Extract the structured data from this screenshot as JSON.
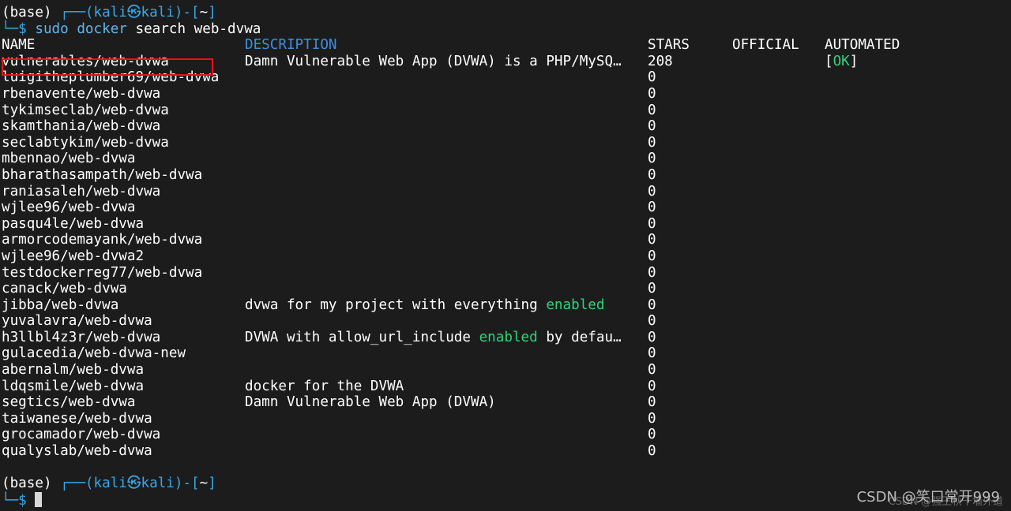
{
  "prompt1": {
    "base": "(base) ",
    "corner": "┌──(",
    "user": "kali㉿",
    "host": "kali",
    "mid": ")-[",
    "dir": "~",
    "end": "]",
    "corner2": "└─$ ",
    "cmd_sudo": "sudo",
    "cmd_docker": "docker",
    "cmd_args": " search web-dvwa"
  },
  "headers": {
    "name": "NAME",
    "description": "DESCRIPTION",
    "stars": "STARS",
    "official": "OFFICIAL",
    "automated": "AUTOMATED"
  },
  "rows": [
    {
      "name": "vulnerables/web-dvwa",
      "desc_a": "Damn Vulnerable Web App (DVWA) is a PHP/MySQ…",
      "desc_hl": "",
      "desc_b": "",
      "stars": "208",
      "auto_open": "[",
      "auto_ok": "OK",
      "auto_close": "]"
    },
    {
      "name": "luigitheplumber69/web-dvwa",
      "desc_a": "",
      "desc_hl": "",
      "desc_b": "",
      "stars": "0",
      "auto_open": "",
      "auto_ok": "",
      "auto_close": ""
    },
    {
      "name": "rbenavente/web-dvwa",
      "desc_a": "",
      "desc_hl": "",
      "desc_b": "",
      "stars": "0",
      "auto_open": "",
      "auto_ok": "",
      "auto_close": ""
    },
    {
      "name": "tykimseclab/web-dvwa",
      "desc_a": "",
      "desc_hl": "",
      "desc_b": "",
      "stars": "0",
      "auto_open": "",
      "auto_ok": "",
      "auto_close": ""
    },
    {
      "name": "skamthania/web-dvwa",
      "desc_a": "",
      "desc_hl": "",
      "desc_b": "",
      "stars": "0",
      "auto_open": "",
      "auto_ok": "",
      "auto_close": ""
    },
    {
      "name": "seclabtykim/web-dvwa",
      "desc_a": "",
      "desc_hl": "",
      "desc_b": "",
      "stars": "0",
      "auto_open": "",
      "auto_ok": "",
      "auto_close": ""
    },
    {
      "name": "mbennao/web-dvwa",
      "desc_a": "",
      "desc_hl": "",
      "desc_b": "",
      "stars": "0",
      "auto_open": "",
      "auto_ok": "",
      "auto_close": ""
    },
    {
      "name": "bharathasampath/web-dvwa",
      "desc_a": "",
      "desc_hl": "",
      "desc_b": "",
      "stars": "0",
      "auto_open": "",
      "auto_ok": "",
      "auto_close": ""
    },
    {
      "name": "raniasaleh/web-dvwa",
      "desc_a": "",
      "desc_hl": "",
      "desc_b": "",
      "stars": "0",
      "auto_open": "",
      "auto_ok": "",
      "auto_close": ""
    },
    {
      "name": "wjlee96/web-dvwa",
      "desc_a": "",
      "desc_hl": "",
      "desc_b": "",
      "stars": "0",
      "auto_open": "",
      "auto_ok": "",
      "auto_close": ""
    },
    {
      "name": "pasqu4le/web-dvwa",
      "desc_a": "",
      "desc_hl": "",
      "desc_b": "",
      "stars": "0",
      "auto_open": "",
      "auto_ok": "",
      "auto_close": ""
    },
    {
      "name": "armorcodemayank/web-dvwa",
      "desc_a": "",
      "desc_hl": "",
      "desc_b": "",
      "stars": "0",
      "auto_open": "",
      "auto_ok": "",
      "auto_close": ""
    },
    {
      "name": "wjlee96/web-dvwa2",
      "desc_a": "",
      "desc_hl": "",
      "desc_b": "",
      "stars": "0",
      "auto_open": "",
      "auto_ok": "",
      "auto_close": ""
    },
    {
      "name": "testdockerreg77/web-dvwa",
      "desc_a": "",
      "desc_hl": "",
      "desc_b": "",
      "stars": "0",
      "auto_open": "",
      "auto_ok": "",
      "auto_close": ""
    },
    {
      "name": "canack/web-dvwa",
      "desc_a": "",
      "desc_hl": "",
      "desc_b": "",
      "stars": "0",
      "auto_open": "",
      "auto_ok": "",
      "auto_close": ""
    },
    {
      "name": "jibba/web-dvwa",
      "desc_a": "dvwa for my project with everything ",
      "desc_hl": "enabled",
      "desc_b": "",
      "stars": "0",
      "auto_open": "",
      "auto_ok": "",
      "auto_close": ""
    },
    {
      "name": "yuvalavra/web-dvwa",
      "desc_a": "",
      "desc_hl": "",
      "desc_b": "",
      "stars": "0",
      "auto_open": "",
      "auto_ok": "",
      "auto_close": ""
    },
    {
      "name": "h3llbl4z3r/web-dvwa",
      "desc_a": "DVWA with allow_url_include ",
      "desc_hl": "enabled",
      "desc_b": " by defau…",
      "stars": "0",
      "auto_open": "",
      "auto_ok": "",
      "auto_close": ""
    },
    {
      "name": "gulacedia/web-dvwa-new",
      "desc_a": "",
      "desc_hl": "",
      "desc_b": "",
      "stars": "0",
      "auto_open": "",
      "auto_ok": "",
      "auto_close": ""
    },
    {
      "name": "abernalm/web-dvwa",
      "desc_a": "",
      "desc_hl": "",
      "desc_b": "",
      "stars": "0",
      "auto_open": "",
      "auto_ok": "",
      "auto_close": ""
    },
    {
      "name": "ldqsmile/web-dvwa",
      "desc_a": "docker for the DVWA",
      "desc_hl": "",
      "desc_b": "",
      "stars": "0",
      "auto_open": "",
      "auto_ok": "",
      "auto_close": ""
    },
    {
      "name": "segtics/web-dvwa",
      "desc_a": "Damn Vulnerable Web App (DVWA)",
      "desc_hl": "",
      "desc_b": "",
      "stars": "0",
      "auto_open": "",
      "auto_ok": "",
      "auto_close": ""
    },
    {
      "name": "taiwanese/web-dvwa",
      "desc_a": "",
      "desc_hl": "",
      "desc_b": "",
      "stars": "0",
      "auto_open": "",
      "auto_ok": "",
      "auto_close": ""
    },
    {
      "name": "grocamador/web-dvwa",
      "desc_a": "",
      "desc_hl": "",
      "desc_b": "",
      "stars": "0",
      "auto_open": "",
      "auto_ok": "",
      "auto_close": ""
    },
    {
      "name": "qualyslab/web-dvwa",
      "desc_a": "",
      "desc_hl": "",
      "desc_b": "",
      "stars": "0",
      "auto_open": "",
      "auto_ok": "",
      "auto_close": ""
    }
  ],
  "prompt2": {
    "base": "(base) ",
    "corner": "┌──(",
    "user": "kali㉿",
    "host": "kali",
    "mid": ")-[",
    "dir": "~",
    "end": "]",
    "corner2": "└─$ "
  },
  "watermark": {
    "main": "CSDN @笑口常开999",
    "under": "CSDN @强王秋千墙外道"
  },
  "colors": {
    "background": "#1c1c1c",
    "prompt": "#39a7e8",
    "command": "#5fb7ee",
    "highlight_word": "#2fd37a",
    "annotation_box": "#e0151a"
  }
}
